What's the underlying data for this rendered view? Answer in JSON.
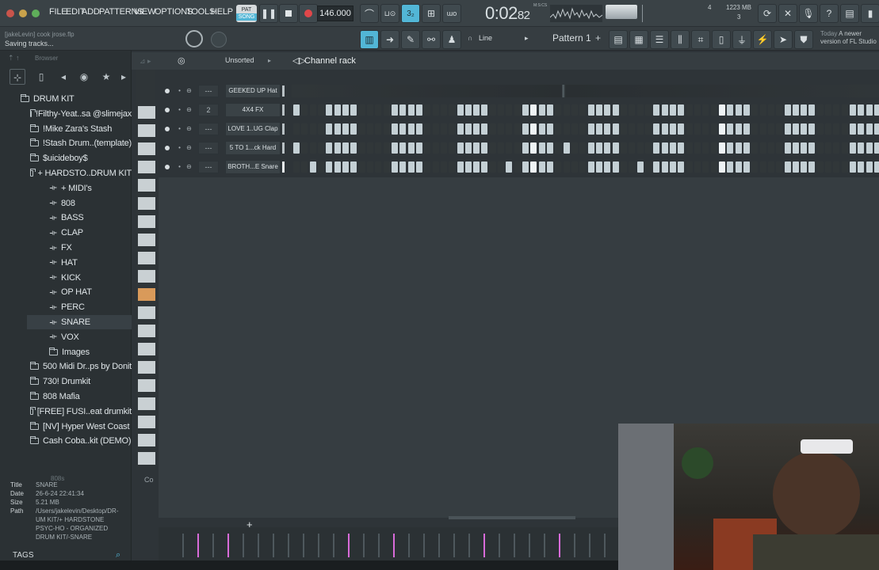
{
  "menu": [
    "FILE",
    "EDIT",
    "ADD",
    "PATTERNS",
    "VIEW",
    "OPTIONS",
    "TOOLS",
    "HELP"
  ],
  "transport": {
    "mode": "SONG",
    "pat_label": "PAT",
    "tempo": "146.000",
    "time_main": "0:02",
    "time_frac": "82",
    "time_unit": "M:S:CS"
  },
  "status": {
    "memory": "1223 MB",
    "cpu_count": "3",
    "voice_count": "4"
  },
  "hint": {
    "file": "[jakeLevin] cook jrose.flp",
    "message": "Saving tracks..."
  },
  "pattern": {
    "name": "Pattern 1",
    "snap": "Line"
  },
  "news": {
    "title": "Today",
    "text": "A newer version of FL Studio"
  },
  "browser": {
    "title": "Browser",
    "items": [
      {
        "label": "DRUM KIT",
        "type": "folder",
        "indent": 0
      },
      {
        "label": "!Filthy-Yeat..sa @slimejax",
        "type": "folder",
        "indent": 1
      },
      {
        "label": "!Mike Zara's Stash",
        "type": "folder",
        "indent": 1
      },
      {
        "label": "!Stash Drum..(template)",
        "type": "folder",
        "indent": 1
      },
      {
        "label": "$uicideboy$",
        "type": "folder",
        "indent": 1
      },
      {
        "label": "+ HARDSTO..DRUM KIT",
        "type": "folder",
        "indent": 1
      },
      {
        "label": "+ MIDI's",
        "type": "plug",
        "indent": 2
      },
      {
        "label": "808",
        "type": "plug",
        "indent": 2
      },
      {
        "label": "BASS",
        "type": "plug",
        "indent": 2
      },
      {
        "label": "CLAP",
        "type": "plug",
        "indent": 2
      },
      {
        "label": "FX",
        "type": "plug",
        "indent": 2
      },
      {
        "label": "HAT",
        "type": "plug",
        "indent": 2
      },
      {
        "label": "KICK",
        "type": "plug",
        "indent": 2
      },
      {
        "label": "OP HAT",
        "type": "plug",
        "indent": 2
      },
      {
        "label": "PERC",
        "type": "plug",
        "indent": 2
      },
      {
        "label": "SNARE",
        "type": "plug",
        "indent": 2
      },
      {
        "label": "VOX",
        "type": "plug",
        "indent": 2
      },
      {
        "label": "Images",
        "type": "folder",
        "indent": 2
      },
      {
        "label": "500 Midi Dr..ps by Donit",
        "type": "folder",
        "indent": 1
      },
      {
        "label": "730! Drumkit",
        "type": "folder",
        "indent": 1
      },
      {
        "label": "808 Mafia",
        "type": "folder",
        "indent": 1
      },
      {
        "label": "[FREE] FUSI..eat drumkit",
        "type": "folder",
        "indent": 1
      },
      {
        "label": "[NV] Hyper West Coast",
        "type": "folder",
        "indent": 1
      },
      {
        "label": "Cash Coba..kit (DEMO)",
        "type": "folder",
        "indent": 1
      }
    ],
    "info": [
      {
        "k": "Title",
        "v": "SNARE"
      },
      {
        "k": "Date",
        "v": "26-6-24 22:41:34"
      },
      {
        "k": "Size",
        "v": "5.21 MB"
      },
      {
        "k": "Path",
        "v": "/Users/jakelevin/Desktop/DR-UM KIT/+ HARDSTONE PSYC-HO - ORGANIZED DRUM KIT/-SNARE"
      }
    ],
    "tags_label": "TAGS"
  },
  "rack": {
    "title": "Channel rack",
    "filter": "Unsorted",
    "channels": [
      {
        "name": "GEEKED UP Hat",
        "route": "---",
        "steps": ""
      },
      {
        "name": "4X4 FX",
        "route": "2",
        "steps": "1000111100001111000011110000111100001111000011110000111100001111000011110000"
      },
      {
        "name": "LOVE 1..UG Clap",
        "route": "---",
        "steps": "0000111100001111000011110000111100001111000011110000111100001111000011110000"
      },
      {
        "name": "5 TO 1...ck Hard",
        "route": "---",
        "steps": "1000111100001111000011110000111101001111000011110000111100001111000011110000"
      },
      {
        "name": "BROTH...E Snare",
        "route": "---",
        "steps": "0010111100001111000011110010111100001111001011110000111100001111000011110000"
      }
    ]
  },
  "colors": {
    "accent": "#52b6d6",
    "pink": "#d86bd9",
    "orange_key": "#d99a5a",
    "purple": "#a24fd8"
  },
  "cover_label": "Co"
}
